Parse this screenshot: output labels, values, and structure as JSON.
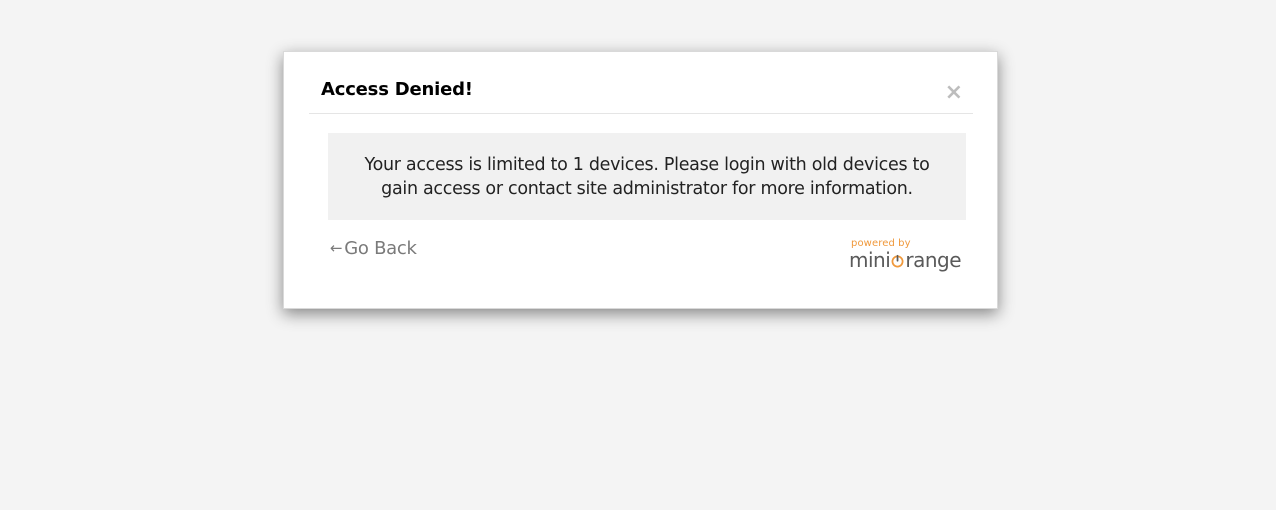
{
  "dialog": {
    "title": "Access Denied!",
    "close_glyph": "×",
    "message": "Your access is limited to 1 devices. Please login with old devices to gain access or contact site administrator for more information.",
    "go_back": {
      "arrow": "←",
      "label": "Go Back"
    }
  },
  "branding": {
    "powered_by": "powered by",
    "brand_part1": "mini",
    "brand_part2": "range",
    "accent_color": "#f0993c",
    "text_color": "#5a5a5a"
  },
  "icons": {
    "close": "close-icon",
    "back_arrow": "arrow-left-icon",
    "logo_o": "miniorange-o-icon"
  }
}
